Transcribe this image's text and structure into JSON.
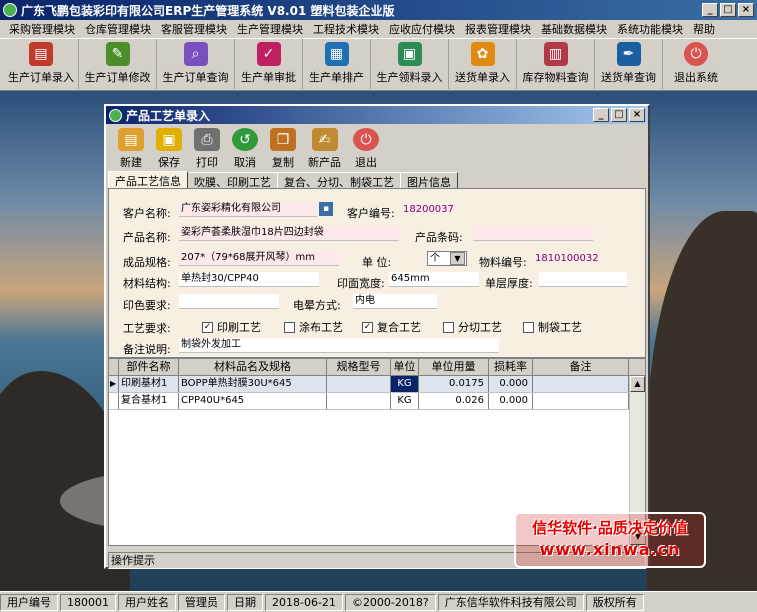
{
  "app": {
    "title": "广东飞鹏包装彩印有限公司ERP生产管理系统  V8.01  塑料包装企业版"
  },
  "window_buttons": [
    "_",
    "□",
    "×"
  ],
  "menu": [
    "采购管理模块",
    "仓库管理模块",
    "客服管理模块",
    "生产管理模块",
    "工程技术模块",
    "应收应付模块",
    "报表管理模块",
    "基础数据模块",
    "系统功能模块",
    "帮助"
  ],
  "toolbar": [
    {
      "label": "生产订单录入",
      "icon": "pdf-icon",
      "color": "#c0392b"
    },
    {
      "label": "生产订单修改",
      "icon": "edit-doc-icon",
      "color": "#4a8f2a"
    },
    {
      "label": "生产订单查询",
      "icon": "search-doc-icon",
      "color": "#7a4fc0"
    },
    {
      "label": "生产单审批",
      "icon": "approve-icon",
      "color": "#c02060"
    },
    {
      "label": "生产单排产",
      "icon": "schedule-icon",
      "color": "#1f6fb5"
    },
    {
      "label": "生产领料录入",
      "icon": "material-icon",
      "color": "#2e8b57"
    },
    {
      "label": "送货单录入",
      "icon": "flower-icon",
      "color": "#e08a10"
    },
    {
      "label": "库存物料查询",
      "icon": "stock-icon",
      "color": "#b23a48"
    },
    {
      "label": "送货单查询",
      "icon": "pen-icon",
      "color": "#1b5fa0"
    },
    {
      "label": "退出系统",
      "icon": "exit-icon",
      "color": "#d9534f"
    }
  ],
  "dialog": {
    "title": "产品工艺单录入",
    "toolbar": [
      {
        "label": "新建",
        "icon": "new-icon",
        "color": "#e0a030"
      },
      {
        "label": "保存",
        "icon": "save-icon",
        "color": "#e0b000"
      },
      {
        "label": "打印",
        "icon": "print-icon",
        "color": "#707070"
      },
      {
        "label": "取消",
        "icon": "cancel-icon",
        "color": "#2e9a3a"
      },
      {
        "label": "复制",
        "icon": "copy-icon",
        "color": "#c07020"
      },
      {
        "label": "新产品",
        "icon": "new-product-icon",
        "color": "#c08a30"
      },
      {
        "label": "退出",
        "icon": "exit-icon",
        "color": "#d9534f"
      }
    ],
    "tabs": [
      "产品工艺信息",
      "吹膜、印刷工艺",
      "复合、分切、制袋工艺",
      "图片信息"
    ],
    "form": {
      "customer_name_label": "客户名称:",
      "customer_name": "广东姿彩精化有限公司",
      "customer_no_label": "客户编号:",
      "customer_no": "18200037",
      "product_name_label": "产品名称:",
      "product_name": "姿彩芦荟柔肤湿巾18片四边封袋",
      "barcode_label": "产品条码:",
      "barcode": "",
      "spec_label": "成品规格:",
      "spec": "207*（79*68展开风琴）mm",
      "unit_label": "单  位:",
      "unit": "个",
      "material_no_label": "物料编号:",
      "material_no": "1810100032",
      "structure_label": "材料结构:",
      "structure": "单热封30/CPP40",
      "print_width_label": "印面宽度:",
      "print_width": "645mm",
      "layer_thickness_label": "单层厚度:",
      "layer_thickness": "",
      "color_req_label": "印色要求:",
      "color_req": "",
      "corona_label": "电晕方式:",
      "corona": "内电",
      "process_label": "工艺要求:",
      "processes": [
        {
          "label": "印刷工艺",
          "checked": true
        },
        {
          "label": "涂布工艺",
          "checked": false
        },
        {
          "label": "复合工艺",
          "checked": true
        },
        {
          "label": "分切工艺",
          "checked": false
        },
        {
          "label": "制袋工艺",
          "checked": false
        }
      ],
      "remark_label": "备注说明:",
      "remark": "制袋外发加工"
    },
    "grid": {
      "columns": [
        "部件名称",
        "材料品名及规格",
        "规格型号",
        "单位",
        "单位用量",
        "损耗率",
        "备注"
      ],
      "rows": [
        {
          "part": "印刷基材1",
          "material": "BOPP单热封膜30U*645",
          "model": "",
          "unit": "KG",
          "usage": "0.0175",
          "loss": "0.000",
          "note": ""
        },
        {
          "part": "复合基材1",
          "material": "CPP40U*645",
          "model": "",
          "unit": "KG",
          "usage": "0.026",
          "loss": "0.000",
          "note": ""
        }
      ]
    },
    "hint": "操作提示"
  },
  "statusbar": [
    "用户编号",
    "180001",
    "用户姓名",
    "管理员",
    "日期",
    "2018-06-21",
    "©2000-2018?",
    "广东信华软件科技有限公司",
    "版权所有"
  ],
  "ad": {
    "line1": "信华软件·品质决定价值",
    "line2": "www.xinwa.cn"
  }
}
